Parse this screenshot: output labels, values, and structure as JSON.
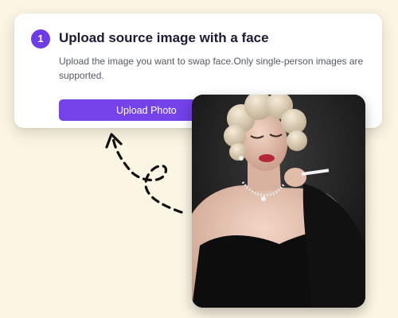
{
  "step": {
    "number": "1",
    "title": "Upload source image with a face",
    "description": "Upload the image you want to swap face.Only single-person images are supported.",
    "button_label": "Upload Photo"
  },
  "colors": {
    "background": "#fbf5e3",
    "accent": "#7442e8",
    "card": "#ffffff"
  },
  "icons": [
    "curved-dashed-arrow-icon"
  ]
}
